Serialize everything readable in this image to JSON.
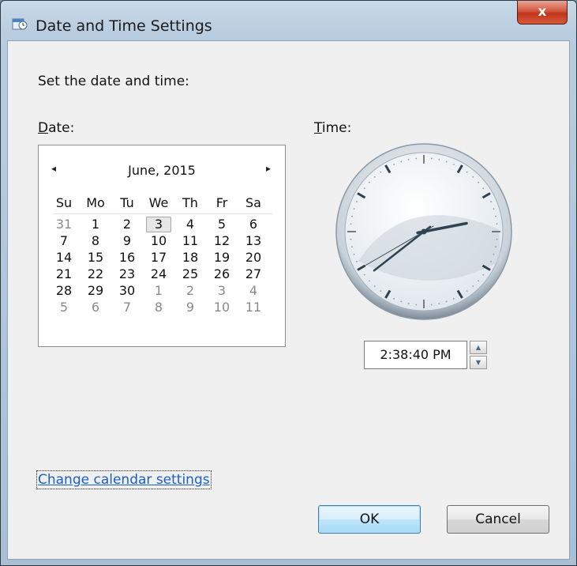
{
  "window": {
    "title": "Date and Time Settings",
    "close_label": "x"
  },
  "prompt": "Set the date and time:",
  "date_label": {
    "key": "D",
    "rest": "ate:"
  },
  "time_label": {
    "key": "T",
    "rest": "ime:"
  },
  "calendar": {
    "month_label": "June, 2015",
    "prev_icon": "◂",
    "next_icon": "▸",
    "weekdays": [
      "Su",
      "Mo",
      "Tu",
      "We",
      "Th",
      "Fr",
      "Sa"
    ],
    "weeks": [
      [
        "31",
        "1",
        "2",
        "3",
        "4",
        "5",
        "6"
      ],
      [
        "7",
        "8",
        "9",
        "10",
        "11",
        "12",
        "13"
      ],
      [
        "14",
        "15",
        "16",
        "17",
        "18",
        "19",
        "20"
      ],
      [
        "21",
        "22",
        "23",
        "24",
        "25",
        "26",
        "27"
      ],
      [
        "28",
        "29",
        "30",
        "1",
        "2",
        "3",
        "4"
      ],
      [
        "5",
        "6",
        "7",
        "8",
        "9",
        "10",
        "11"
      ]
    ],
    "selected_day": "3"
  },
  "clock": {
    "hour": 2,
    "minute": 38,
    "second": 40
  },
  "time_value": "2:38:40 PM",
  "links": {
    "change_calendar": "Change calendar settings"
  },
  "buttons": {
    "ok": "OK",
    "cancel": "Cancel"
  },
  "colors": {
    "link": "#1a5ec7",
    "close_button": "#c0351c",
    "ok_border": "#3c7fb1"
  }
}
